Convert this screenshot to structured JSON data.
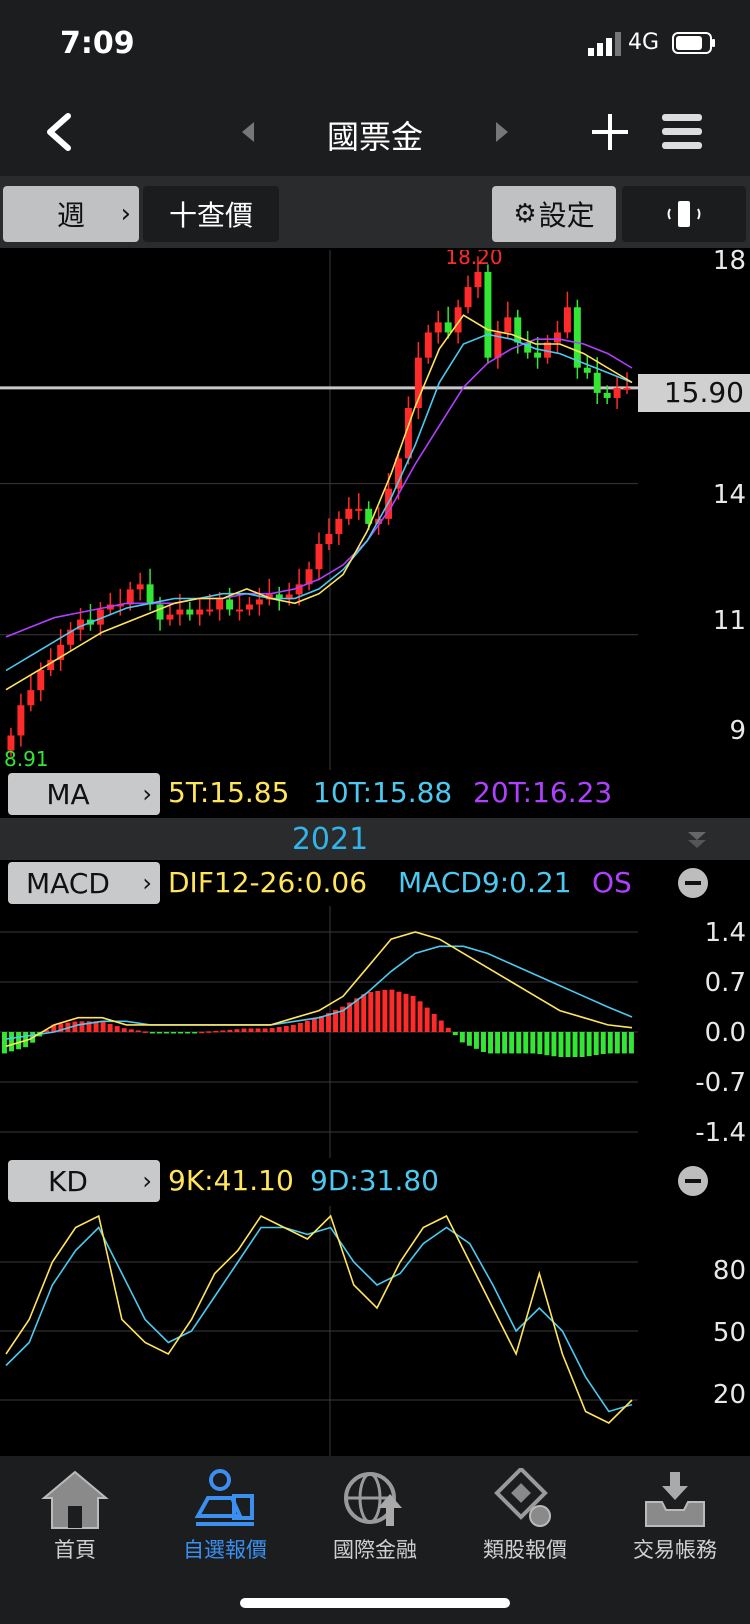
{
  "status": {
    "time": "7:09",
    "network": "4G"
  },
  "header": {
    "title": "國票金"
  },
  "toolbar": {
    "period": "週",
    "quote": "十查價",
    "settings": "設定"
  },
  "price_axis": {
    "labels": [
      "18",
      "14",
      "11",
      "9"
    ],
    "last_price": "15.90"
  },
  "price_chart": {
    "high_label": "18.20",
    "low_label": "8.91"
  },
  "ma": {
    "tag": "MA",
    "ma5": "5T:15.85",
    "ma10": "10T:15.88",
    "ma20": "20T:16.23"
  },
  "year": "2021",
  "macd": {
    "tag": "MACD",
    "dif": "DIF12-26:0.06",
    "macd9": "MACD9:0.21",
    "os": "OS",
    "axis": [
      "1.4",
      "0.7",
      "0.0",
      "-0.7",
      "-1.4"
    ]
  },
  "kd": {
    "tag": "KD",
    "k": "9K:41.10",
    "d": "9D:31.80",
    "axis": [
      "80",
      "50",
      "20"
    ]
  },
  "tabs": [
    {
      "label": "首頁",
      "icon": "home-icon"
    },
    {
      "label": "自選報價",
      "icon": "watchlist-icon"
    },
    {
      "label": "國際金融",
      "icon": "globe-icon"
    },
    {
      "label": "類股報價",
      "icon": "sector-icon"
    },
    {
      "label": "交易帳務",
      "icon": "inbox-icon"
    }
  ],
  "colors": {
    "up": "#ff2a2a",
    "down": "#33e633",
    "ma5": "#ffe45c",
    "ma10": "#4cc9f0",
    "ma20": "#b040ff",
    "active_tab": "#3a8ff0"
  },
  "chart_data": [
    {
      "type": "candlestick",
      "title": "",
      "ylim": [
        8.91,
        18.2
      ],
      "series": [
        {
          "name": "price",
          "values": [
            9.0,
            9.6,
            9.9,
            10.3,
            10.5,
            10.8,
            11.1,
            11.3,
            11.2,
            11.5,
            11.6,
            11.6,
            11.9,
            12.0,
            11.6,
            11.3,
            11.4,
            11.5,
            11.4,
            11.5,
            11.5,
            11.7,
            11.5,
            11.5,
            11.6,
            11.7,
            11.8,
            11.7,
            11.8,
            12.0,
            12.3,
            12.8,
            13.0,
            13.3,
            13.5,
            13.5,
            13.2,
            13.3,
            13.9,
            14.5,
            15.5,
            16.5,
            17.0,
            17.2,
            17.0,
            17.5,
            17.9,
            18.2,
            16.5,
            17.0,
            17.3,
            16.8,
            16.6,
            16.5,
            16.8,
            17.0,
            17.5,
            16.3,
            16.2,
            15.8,
            15.7,
            15.9,
            15.9
          ]
        },
        {
          "name": "5T",
          "values": [
            9.5,
            9.8,
            10.1,
            10.4,
            10.7,
            10.9,
            11.1,
            11.3,
            11.4,
            11.4,
            11.6,
            11.4,
            11.3,
            11.5,
            11.9,
            12.8,
            14.0,
            15.4,
            16.6,
            17.3,
            17.0,
            16.9,
            16.7,
            16.7,
            16.5,
            16.2,
            15.9
          ]
        },
        {
          "name": "10T",
          "values": [
            9.9,
            10.2,
            10.5,
            10.8,
            11.0,
            11.2,
            11.3,
            11.4,
            11.4,
            11.5,
            11.5,
            11.4,
            11.4,
            11.6,
            12.0,
            12.6,
            13.5,
            14.6,
            15.9,
            16.7,
            16.9,
            16.8,
            16.6,
            16.5,
            16.3,
            16.1,
            15.9
          ]
        },
        {
          "name": "20T",
          "values": [
            10.6,
            10.8,
            11.0,
            11.1,
            11.2,
            11.3,
            11.3,
            11.3,
            11.4,
            11.4,
            11.5,
            11.5,
            11.6,
            11.8,
            12.1,
            12.6,
            13.3,
            14.2,
            15.0,
            15.8,
            16.3,
            16.6,
            16.8,
            16.8,
            16.7,
            16.5,
            16.2
          ]
        }
      ]
    },
    {
      "type": "line",
      "title": "MACD",
      "ylim": [
        -1.4,
        1.4
      ],
      "series": [
        {
          "name": "DIF12-26",
          "values": [
            -0.2,
            -0.1,
            0.1,
            0.2,
            0.2,
            0.1,
            0.1,
            0.1,
            0.1,
            0.1,
            0.1,
            0.1,
            0.2,
            0.3,
            0.5,
            0.9,
            1.3,
            1.4,
            1.3,
            1.1,
            0.9,
            0.7,
            0.5,
            0.3,
            0.2,
            0.1,
            0.06
          ]
        },
        {
          "name": "MACD9",
          "values": [
            -0.1,
            -0.05,
            0.0,
            0.1,
            0.15,
            0.15,
            0.1,
            0.1,
            0.1,
            0.1,
            0.1,
            0.1,
            0.15,
            0.2,
            0.3,
            0.55,
            0.85,
            1.1,
            1.2,
            1.2,
            1.1,
            0.95,
            0.8,
            0.65,
            0.5,
            0.35,
            0.21
          ]
        },
        {
          "name": "OS",
          "values": [
            -0.3,
            -0.2,
            0.1,
            0.15,
            0.15,
            0.05,
            0.0,
            -0.02,
            0.0,
            0.02,
            0.05,
            0.05,
            0.1,
            0.2,
            0.35,
            0.55,
            0.6,
            0.5,
            0.2,
            -0.15,
            -0.3,
            -0.3,
            -0.3,
            -0.35,
            -0.35,
            -0.3,
            -0.3
          ]
        }
      ]
    },
    {
      "type": "line",
      "title": "KD",
      "ylim": [
        0,
        100
      ],
      "series": [
        {
          "name": "9K",
          "values": [
            40,
            55,
            80,
            95,
            100,
            55,
            45,
            40,
            55,
            75,
            85,
            100,
            95,
            90,
            100,
            70,
            60,
            80,
            95,
            100,
            80,
            60,
            40,
            75,
            40,
            15,
            10,
            20
          ]
        },
        {
          "name": "9D",
          "values": [
            35,
            45,
            70,
            85,
            95,
            75,
            55,
            45,
            50,
            65,
            80,
            95,
            95,
            92,
            95,
            80,
            70,
            75,
            88,
            95,
            88,
            70,
            50,
            60,
            50,
            30,
            15,
            18
          ]
        }
      ]
    }
  ]
}
